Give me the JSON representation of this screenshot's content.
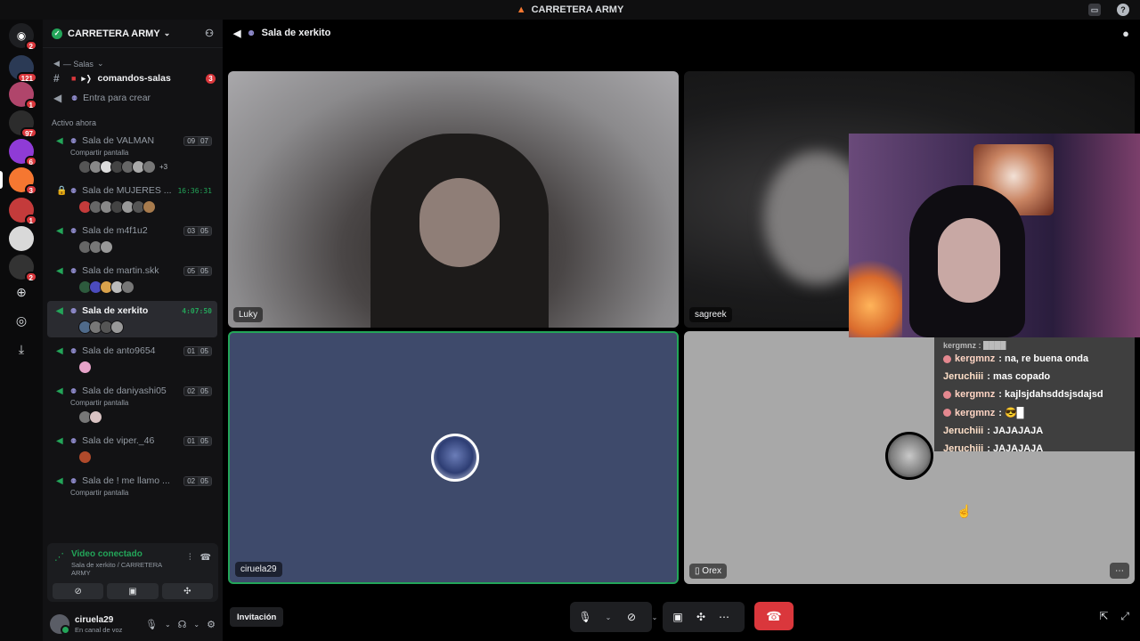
{
  "titlebar": {
    "title": "CARRETERA ARMY",
    "icon": "flame-logo-icon"
  },
  "server_rail": {
    "servers": [
      {
        "name": "home-discord-icon",
        "badge": "2",
        "color": "#5865f2"
      },
      {
        "name": "server-z",
        "badge": "121",
        "color": "#2b3a55"
      },
      {
        "name": "server-pink-avatar",
        "badge": "1",
        "color": "#b0456b"
      },
      {
        "name": "server-ks",
        "badge": "97",
        "color": "#2c2c2c"
      },
      {
        "name": "server-purple",
        "badge": "6",
        "color": "#8f3bd6"
      },
      {
        "name": "server-carretera",
        "badge": "3",
        "color": "#f57731"
      },
      {
        "name": "server-red-avatar",
        "badge": "1",
        "color": "#c43b3b"
      },
      {
        "name": "server-striped",
        "badge": "",
        "color": "#d9d9d9"
      },
      {
        "name": "server-dark",
        "badge": "2",
        "color": "#333"
      }
    ]
  },
  "sidebar": {
    "server_name": "CARRETERA ARMY",
    "category": "— Salas",
    "text_channel": {
      "name": "comandos-salas",
      "count": "3"
    },
    "create_channel": "Entra para crear",
    "active_now": "Activo ahora",
    "voice_channels": [
      {
        "name": "Sala de VALMAN",
        "sub": "Compartir pantalla",
        "a": "09",
        "b": "07",
        "avatars": [
          "#555",
          "#888",
          "#ddd",
          "#444",
          "#666",
          "#aaa",
          "#777"
        ],
        "more": "+3"
      },
      {
        "name": "Sala de MUJERES ...",
        "timer": "16:36:31",
        "locked": true,
        "avatars": [
          "#c43b3b",
          "#666",
          "#888",
          "#444",
          "#999",
          "#555",
          "#a87b4d"
        ]
      },
      {
        "name": "Sala de m4f1u2",
        "a": "03",
        "b": "05",
        "avatars": [
          "#666",
          "#777",
          "#999"
        ]
      },
      {
        "name": "Sala de martin.skk",
        "a": "05",
        "b": "05",
        "avatars": [
          "#2d5a3d",
          "#4b4bbd",
          "#d9a24b",
          "#bbb",
          "#777"
        ]
      },
      {
        "name": "Sala de xerkito",
        "timer": "4:07:50",
        "selected": true,
        "avatars": [
          "#4f6a8a",
          "#777",
          "#555",
          "#999"
        ]
      },
      {
        "name": "Sala de anto9654",
        "a": "01",
        "b": "05",
        "avatars": [
          "#e7a3c9"
        ]
      },
      {
        "name": "Sala de daniyashi05",
        "sub": "Compartir pantalla",
        "a": "02",
        "b": "05",
        "avatars": [
          "#777",
          "#d9c3c3"
        ]
      },
      {
        "name": "Sala de viper._46",
        "a": "01",
        "b": "05",
        "avatars": [
          "#b04a2b"
        ]
      },
      {
        "name": "Sala de ! me llamo ...",
        "sub": "Compartir pantalla",
        "a": "02",
        "b": "05",
        "avatars": []
      }
    ]
  },
  "voice_panel": {
    "title": "Video conectado",
    "subtitle": "Sala de xerkito / CARRETERA ARMY"
  },
  "user": {
    "name": "ciruela29",
    "status": "En canal de voz"
  },
  "main": {
    "channel": "Sala de xerkito",
    "tiles": {
      "luky": "Luky",
      "sagreek": "sagreek",
      "ciruela": "ciruela29",
      "orex": "Orex"
    },
    "invite": "Invitación"
  },
  "chat": {
    "clipped": "kergmnz : ████",
    "lines": [
      {
        "user": "kergmnz",
        "text": ": na, re buena onda",
        "badge": true
      },
      {
        "user": "Jeruchiii",
        "text": ": mas copado",
        "badge": false
      },
      {
        "user": "kergmnz",
        "text": ": kajlsjdahsddsjsdajsd",
        "badge": true
      },
      {
        "user": "kergmnz",
        "text": ": 😎█",
        "badge": true
      },
      {
        "user": "Jeruchiii",
        "text": ": JAJAJAJA",
        "badge": false
      },
      {
        "user": "Jeruchiii",
        "text": ": JAJAJAJA",
        "badge": false
      }
    ]
  },
  "colors": {
    "accent_green": "#23a559",
    "danger": "#da373c",
    "panel": "#121214"
  }
}
